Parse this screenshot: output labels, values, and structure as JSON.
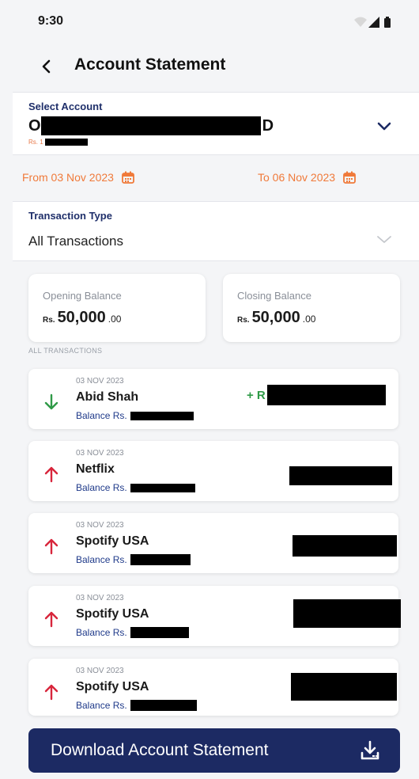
{
  "status": {
    "time": "9:30"
  },
  "header": {
    "title": "Account Statement"
  },
  "account": {
    "label": "Select Account",
    "name_first": "O",
    "name_last": "D",
    "balance_prefix": "Rs. 1"
  },
  "dates": {
    "from": "From 03 Nov 2023",
    "to": "To 06 Nov 2023"
  },
  "transaction_type": {
    "label": "Transaction Type",
    "value": "All Transactions"
  },
  "balances": {
    "opening": {
      "label": "Opening Balance",
      "currency": "Rs.",
      "amount": "50,000",
      "decimals": ".00"
    },
    "closing": {
      "label": "Closing Balance",
      "currency": "Rs.",
      "amount": "50,000",
      "decimals": ".00"
    }
  },
  "section_label": "ALL TRANSACTIONS",
  "transactions": [
    {
      "date": "03 NOV 2023",
      "name": "Abid Shah",
      "balance_label": "Balance Rs.",
      "direction": "credit",
      "amount_prefix": "+ R"
    },
    {
      "date": "03 NOV 2023",
      "name": "Netflix",
      "balance_label": "Balance Rs.",
      "direction": "debit",
      "amount_prefix": ""
    },
    {
      "date": "03 NOV 2023",
      "name": "Spotify USA",
      "balance_label": "Balance Rs.",
      "direction": "debit",
      "amount_prefix": ""
    },
    {
      "date": "03 NOV 2023",
      "name": "Spotify USA",
      "balance_label": "Balance Rs.",
      "direction": "debit",
      "amount_prefix": ""
    },
    {
      "date": "03 NOV 2023",
      "name": "Spotify USA",
      "balance_label": "Balance Rs.",
      "direction": "debit",
      "amount_prefix": ""
    }
  ],
  "download": {
    "label": "Download Account Statement"
  },
  "colors": {
    "primary": "#1c2a63",
    "accent_orange": "#f07a3a",
    "credit_green": "#2f9a47",
    "debit_red": "#d8263c"
  },
  "icons": {
    "back": "chevron-left-icon",
    "account_dropdown": "chevron-down-icon",
    "calendar": "calendar-icon",
    "credit": "arrow-down-icon",
    "debit": "arrow-up-icon",
    "download": "download-icon"
  }
}
